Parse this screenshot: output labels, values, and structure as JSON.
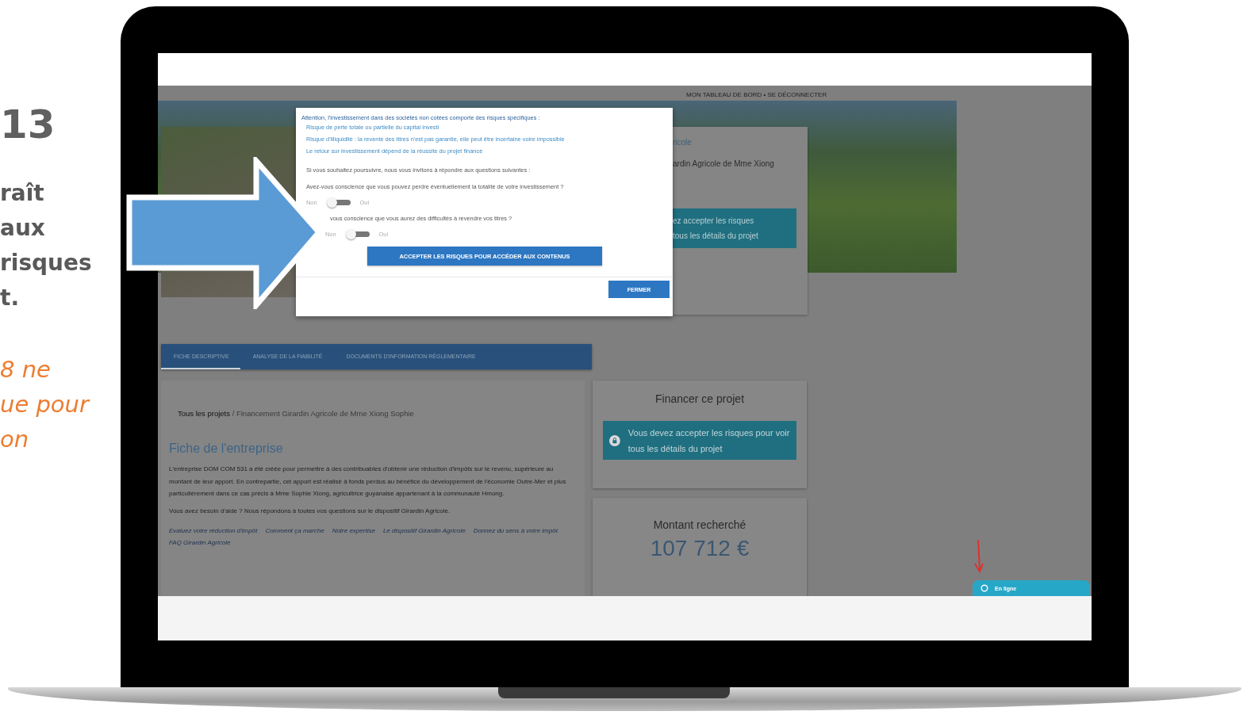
{
  "slide": {
    "number": "13",
    "lines": [
      "raît",
      "aux",
      "risques",
      "t."
    ],
    "note_lines": [
      "8 ne",
      "ue pour",
      "on"
    ]
  },
  "screen": {
    "top_links": "MON TABLEAU DE BORD • SE DÉCONNECTER",
    "side_card": {
      "lines": [
        "ricole",
        "ardin Agricole de Mme Xiong"
      ],
      "notice_lines": [
        "ez accepter les risques",
        "tous les détails du projet"
      ]
    },
    "tabs": [
      {
        "label": "FICHE DESCRIPTIVE",
        "selected": true
      },
      {
        "label": "ANALYSE DE LA FIABILITÉ",
        "selected": false
      },
      {
        "label": "DOCUMENTS D'INFORMATION RÉGLEMENTAIRE",
        "selected": false
      }
    ],
    "breadcrumb": "**Tous les projets** / Financement Girardin Agricole de Mme Xiong Sophie",
    "heading": "Fiche de l'entreprise",
    "paragraphs": [
      "L'entreprise DOM COM 531 a été créée pour permettre à des contribuables d'obtenir une réduction d'impôts sur le revenu, supérieure au montant de leur apport. En contrepartie, cet apport est réalisé à fonds perdus au bénéfice du développement de l'économie Outre-Mer et plus particulièrement dans ce cas précis à Mme Sophie Xiong, agricultrice guyanaise appartenant à la communauté Hmong.",
      "Vous avez besoin d'aide ? Nous répondons à toutes vos questions sur le dispositif Girardin Agricole."
    ],
    "links": [
      "Evaluez votre réduction d'impôt",
      "Comment ça marche",
      "Notre expertise",
      "Le dispositif Girardin Agricole",
      "Donnez du sens à votre impôt",
      "FAQ Girardin Agricole"
    ],
    "fund_card": {
      "title": "Financer ce projet",
      "notice": "Vous devez accepter les risques pour voir tous les détails du projet"
    },
    "amount_card": {
      "title": "Montant recherché",
      "amount": "107 712 €"
    },
    "chat": {
      "label": "En ligne"
    }
  },
  "modal": {
    "title": "Attention, l'investissement dans des sociétés non cotées comporte des risques spécifiques :",
    "risks": [
      "Risque de perte totale ou partielle du capital investi",
      "Risque d'illiquidité : la revente des titres n'est pas garantie, elle peut être incertaine voire impossible",
      "Le retour sur investissement dépend de la réussite du projet financé"
    ],
    "intro": "Si vous souhaitez poursuivre, nous vous invitons à répondre aux questions suivantes :",
    "questions": [
      {
        "text": "Avez-vous conscience que vous pouvez perdre éventuellement la totalité de votre investissement ?",
        "no": "Non",
        "yes": "Oui",
        "on": false
      },
      {
        "text": "vous conscience que vous aurez des difficultés à revendre vos titres ?",
        "no": "Non",
        "yes": "Oui",
        "on": false
      }
    ],
    "accept_button": "ACCEPTER LES RISQUES POUR ACCÉDER AUX CONTENUS",
    "close_button": "FERMER"
  }
}
